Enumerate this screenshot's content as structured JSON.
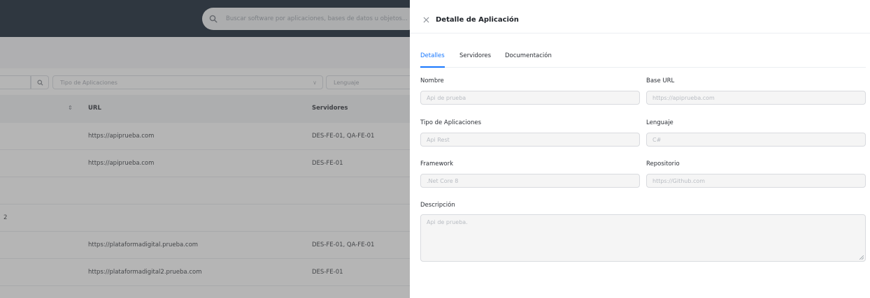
{
  "search": {
    "placeholder": "Buscar software por aplicaciones, bases de datos u objetos..."
  },
  "filters": {
    "tipo_placeholder": "Tipo de Aplicaciones",
    "lenguaje_placeholder": "Lenguaje"
  },
  "table": {
    "headers": {
      "url": "URL",
      "servidores": "Servidores"
    },
    "rows": [
      {
        "lead": "",
        "url": "https://apiprueba.com",
        "servidores": "DES-FE-01, QA-FE-01"
      },
      {
        "lead": "",
        "url": "https://apiprueba.com",
        "servidores": "DES-FE-01"
      },
      {
        "lead": "",
        "url": "",
        "servidores": ""
      },
      {
        "lead": "2",
        "url": "",
        "servidores": ""
      },
      {
        "lead": "",
        "url": "https://plataformadigital.prueba.com",
        "servidores": "DES-FE-01, QA-FE-01"
      },
      {
        "lead": "",
        "url": "https://plataformadigital2.prueba.com",
        "servidores": "DES-FE-01"
      }
    ]
  },
  "drawer": {
    "title": "Detalle de Aplicación",
    "tabs": [
      "Detalles",
      "Servidores",
      "Documentación"
    ],
    "fields": {
      "nombre": {
        "label": "Nombre",
        "value": "Api de prueba"
      },
      "base_url": {
        "label": "Base URL",
        "value": "https://apiprueba.com"
      },
      "tipo": {
        "label": "Tipo de Aplicaciones",
        "value": "Api Rest"
      },
      "lenguaje": {
        "label": "Lenguaje",
        "value": "C#"
      },
      "framework": {
        "label": "Framework",
        "value": ".Net Core 8"
      },
      "repositorio": {
        "label": "Repositorio",
        "value": "https://Github.com"
      },
      "descripcion": {
        "label": "Descripción",
        "value": "Api de prueba."
      }
    }
  },
  "colors": {
    "topbar": "#0b1a2b",
    "accent": "#1677ff",
    "overlay": "rgba(90,90,90,0.45)"
  }
}
